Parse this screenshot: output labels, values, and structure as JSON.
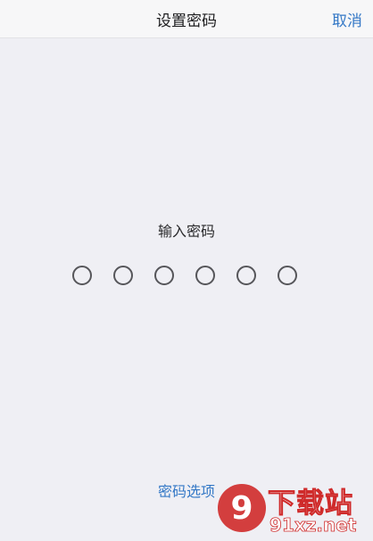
{
  "header": {
    "title": "设置密码",
    "cancel_label": "取消"
  },
  "passcode": {
    "prompt": "输入密码",
    "digits_total": 6,
    "digits_entered": 0
  },
  "footer": {
    "options_label": "密码选项"
  },
  "watermark": {
    "title": "下载站",
    "url": "91xz.net",
    "logo_text": "9",
    "color": "#cf2a2a"
  },
  "colors": {
    "accent": "#3478c6",
    "background": "#efeff4"
  }
}
